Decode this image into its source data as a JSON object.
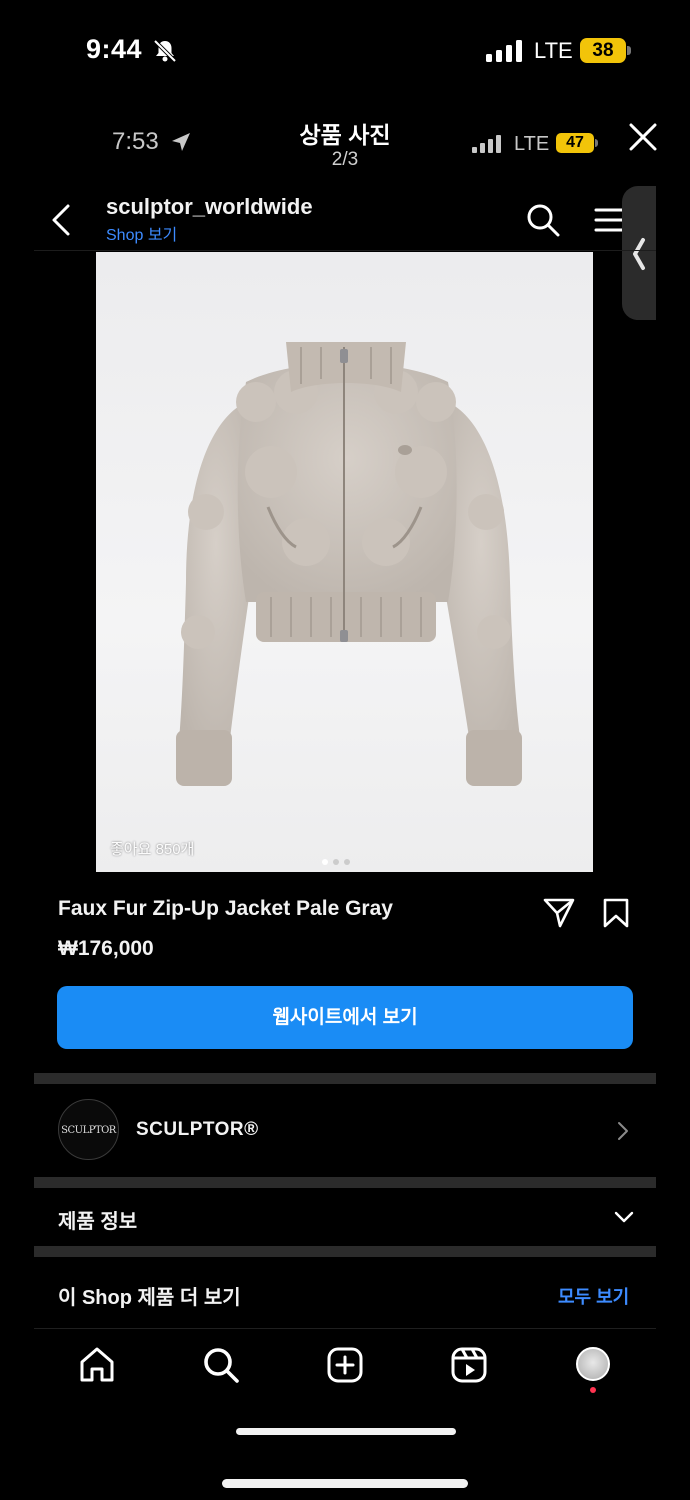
{
  "status_bar": {
    "time": "9:44",
    "network": "LTE",
    "battery": "38",
    "icons": {
      "silent": "bell-slash-icon",
      "signal": "signal-bars-icon"
    },
    "battery_color": "#f2c409"
  },
  "inner_status_bar": {
    "time": "7:53",
    "network": "LTE",
    "battery": "47",
    "icons": {
      "location": "location-arrow-icon",
      "signal": "signal-bars-icon"
    }
  },
  "viewer": {
    "title": "상품 사진",
    "page_counter": "2/3",
    "close_icon": "close-icon"
  },
  "header": {
    "account": "sculptor_worldwide",
    "shop_link": "Shop 보기",
    "icons": [
      "back-arrow-icon",
      "search-icon",
      "menu-icon"
    ]
  },
  "product": {
    "likes": "좋아요 850개",
    "name": "Faux Fur Zip-Up Jacket Pale Gray",
    "price": "₩176,000",
    "cta": "웹사이트에서 보기",
    "cta_color": "#1a8cf5",
    "image_dots": {
      "count": 3,
      "active": 1
    }
  },
  "brand": {
    "logo_text": "SCULPTOR",
    "name": "SCULPTOR®"
  },
  "sections": {
    "product_info": "제품 정보",
    "more_from_shop": "이 Shop 제품 더 보기",
    "see_all": "모두 보기"
  },
  "tab_bar": [
    "home-icon",
    "search-icon",
    "create-icon",
    "reels-icon",
    "profile-avatar"
  ],
  "accent_color": "#3d8bff"
}
